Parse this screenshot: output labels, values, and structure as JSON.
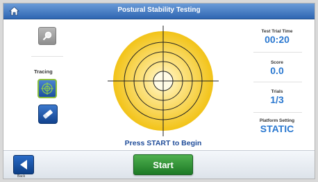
{
  "header": {
    "title": "Postural Stability Testing",
    "home_icon": "home-icon"
  },
  "left_panel": {
    "search_icon": "magnifier-icon",
    "tracing_label": "Tracing",
    "trace_target_icon": "target-crosshair-icon",
    "eraser_icon": "eraser-icon"
  },
  "target": {
    "prompt": "Press START to Begin",
    "ring_count": 5,
    "fill_color": "#f2c318",
    "center_color": "#fff9d6"
  },
  "stats": {
    "test_trial_time": {
      "label": "Test Trial Time",
      "value": "00:20"
    },
    "score": {
      "label": "Score",
      "value": "0.0"
    },
    "trials": {
      "label": "Trials",
      "value": "1/3"
    },
    "platform_setting": {
      "label": "Platform Setting",
      "value": "STATIC"
    }
  },
  "footer": {
    "back_label": "Back",
    "start_label": "Start"
  },
  "colors": {
    "accent_blue": "#2a78d0",
    "start_green": "#2f9a36",
    "title_bar": "#2f66b2"
  }
}
